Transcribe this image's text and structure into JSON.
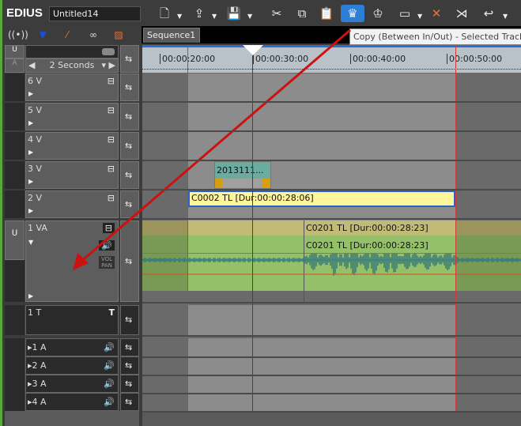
{
  "app": {
    "logo": "EDIUS",
    "project_name": "Untitled14"
  },
  "toolbar": {
    "buttons": [
      "new-project",
      "open",
      "save",
      "cut",
      "copy",
      "paste",
      "copy-between-in-out",
      "cut-between-in-out",
      "ripple-mode",
      "delete",
      "split",
      "undo"
    ],
    "active": "copy-between-in-out",
    "accent": "#2d7fd6"
  },
  "tooltip": "Copy (Between In/Out) - Selected Tracks",
  "sequence_tab": "Sequence1",
  "zoom": {
    "scale_label": "2 Seconds"
  },
  "ruler": {
    "labels": [
      "00:00:20:00",
      "00:00:30:00",
      "00:00:40:00",
      "00:00:50:00"
    ],
    "playhead": "00:00:30:00",
    "in_point": "00:00:23:00",
    "out_point": "00:00:51:00"
  },
  "tracks": [
    {
      "name": "6 V",
      "type": "video"
    },
    {
      "name": "5 V",
      "type": "video"
    },
    {
      "name": "4 V",
      "type": "video"
    },
    {
      "name": "3 V",
      "type": "video"
    },
    {
      "name": "2 V",
      "type": "video"
    },
    {
      "name": "1 VA",
      "type": "video-audio",
      "vol_pan": "VOL PAN"
    },
    {
      "name": "1 T",
      "type": "title"
    },
    {
      "name": "1 A",
      "type": "audio"
    },
    {
      "name": "2 A",
      "type": "audio"
    },
    {
      "name": "3 A",
      "type": "audio"
    },
    {
      "name": "4 A",
      "type": "audio"
    }
  ],
  "clips": {
    "c3v": "2013111...",
    "c2v": "C0002  TL [Dur:00:00:28:06]",
    "c1va_video": "C0201  TL [Dur:00:00:28:23]",
    "c1va_audio": "C0201  TL [Dur:00:00:28:23]"
  },
  "annotation": {
    "arrow_color": "#cc1111"
  }
}
